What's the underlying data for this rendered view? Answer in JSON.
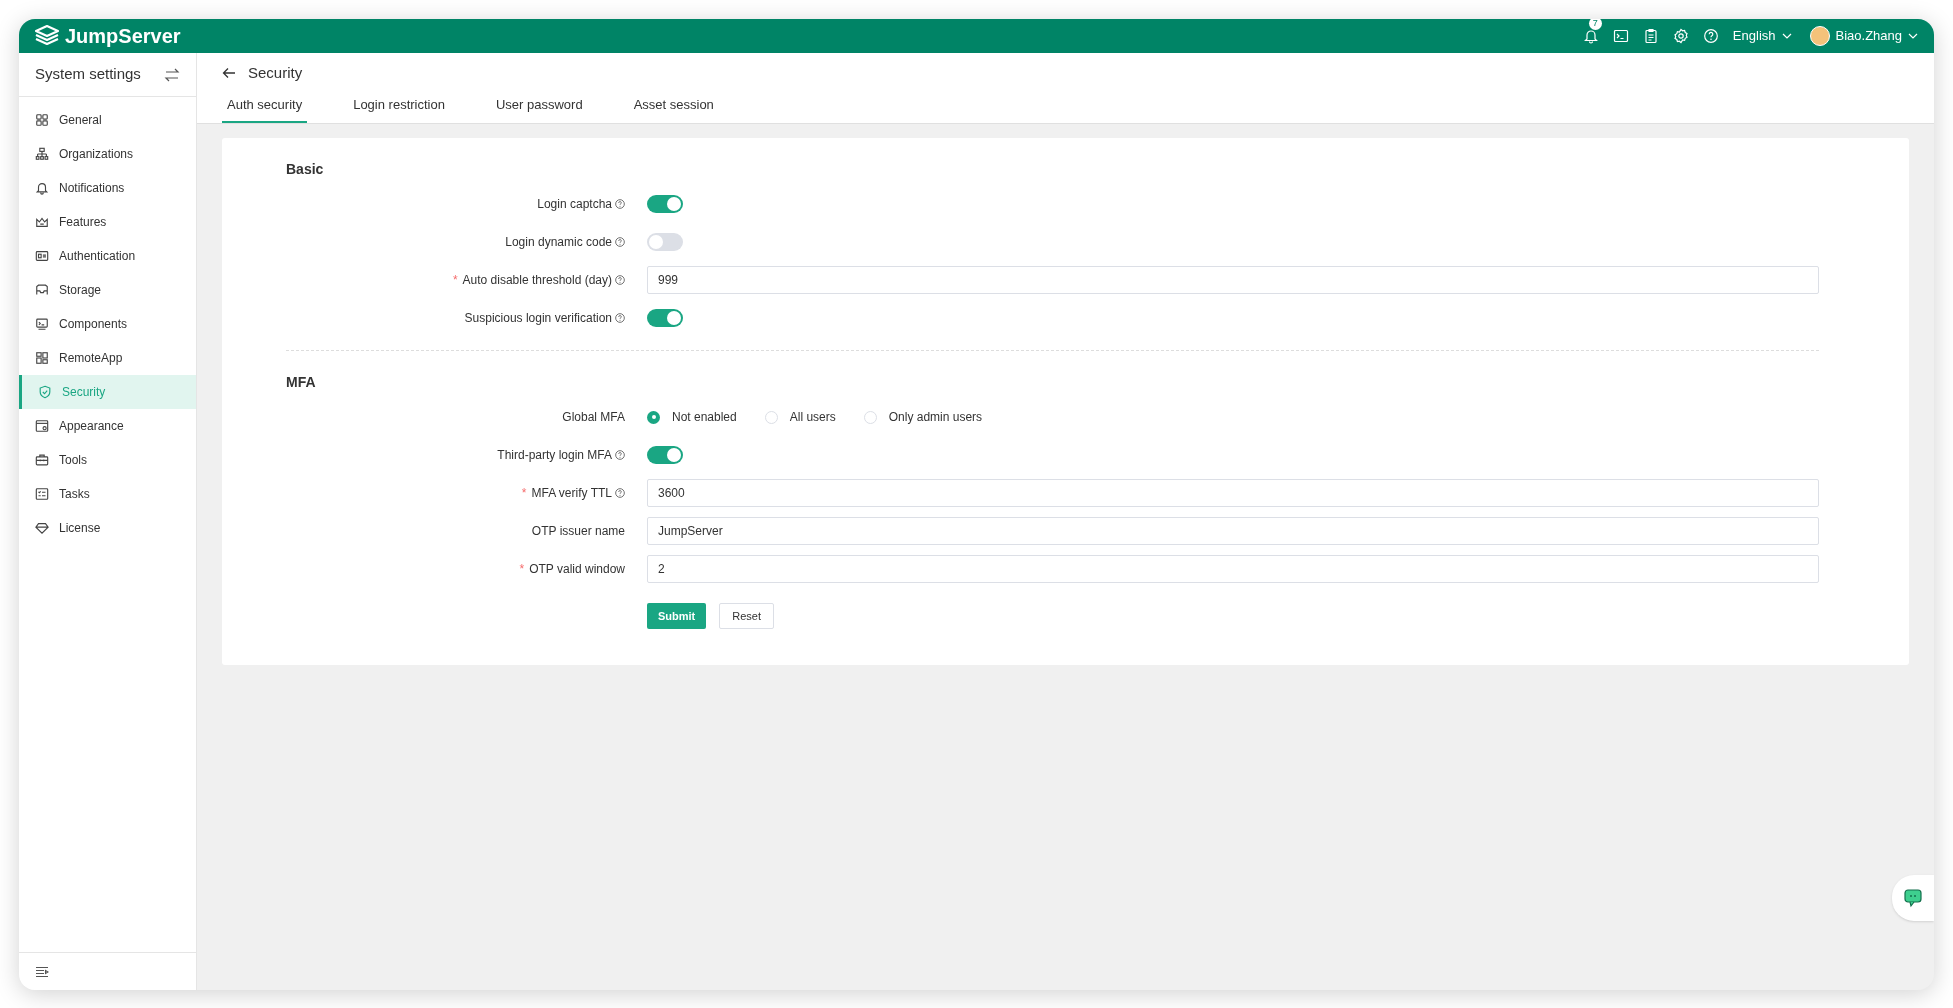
{
  "app": {
    "logo_text": "JumpServer",
    "notification_count": "7",
    "language": "English",
    "user": "Biao.Zhang"
  },
  "sidebar": {
    "title": "System settings",
    "items": [
      {
        "label": "General",
        "selected": false
      },
      {
        "label": "Organizations",
        "selected": false
      },
      {
        "label": "Notifications",
        "selected": false
      },
      {
        "label": "Features",
        "selected": false
      },
      {
        "label": "Authentication",
        "selected": false
      },
      {
        "label": "Storage",
        "selected": false
      },
      {
        "label": "Components",
        "selected": false
      },
      {
        "label": "RemoteApp",
        "selected": false
      },
      {
        "label": "Security",
        "selected": true
      },
      {
        "label": "Appearance",
        "selected": false
      },
      {
        "label": "Tools",
        "selected": false
      },
      {
        "label": "Tasks",
        "selected": false
      },
      {
        "label": "License",
        "selected": false
      }
    ]
  },
  "page": {
    "title": "Security",
    "tabs": [
      {
        "label": "Auth security",
        "selected": true
      },
      {
        "label": "Login restriction",
        "selected": false
      },
      {
        "label": "User password",
        "selected": false
      },
      {
        "label": "Asset session",
        "selected": false
      }
    ]
  },
  "sections": [
    {
      "title": "Basic",
      "fields": [
        {
          "kind": "switch",
          "label": "Login captcha",
          "help": true,
          "on": true
        },
        {
          "kind": "switch",
          "label": "Login dynamic code",
          "help": true,
          "on": false
        },
        {
          "kind": "input",
          "required_mark": "*",
          "label": "Auto disable threshold (day)",
          "help": true,
          "value": "999"
        },
        {
          "kind": "switch",
          "label": "Suspicious login verification",
          "help": true,
          "on": true
        }
      ]
    },
    {
      "title": "MFA",
      "fields": [
        {
          "kind": "radio",
          "label": "Global MFA",
          "help": false,
          "options": [
            {
              "label": "Not enabled",
              "selected": true
            },
            {
              "label": "All users",
              "selected": false
            },
            {
              "label": "Only admin users",
              "selected": false
            }
          ]
        },
        {
          "kind": "switch",
          "label": "Third-party login MFA",
          "help": true,
          "on": true
        },
        {
          "kind": "input",
          "required_mark": "*",
          "label": "MFA verify TTL",
          "help": true,
          "value": "3600"
        },
        {
          "kind": "input",
          "label": "OTP issuer name",
          "help": false,
          "value": "JumpServer"
        },
        {
          "kind": "input",
          "required_mark": "*",
          "label": "OTP valid window",
          "help": false,
          "value": "2"
        }
      ]
    }
  ],
  "buttons": {
    "submit": "Submit",
    "reset": "Reset"
  }
}
